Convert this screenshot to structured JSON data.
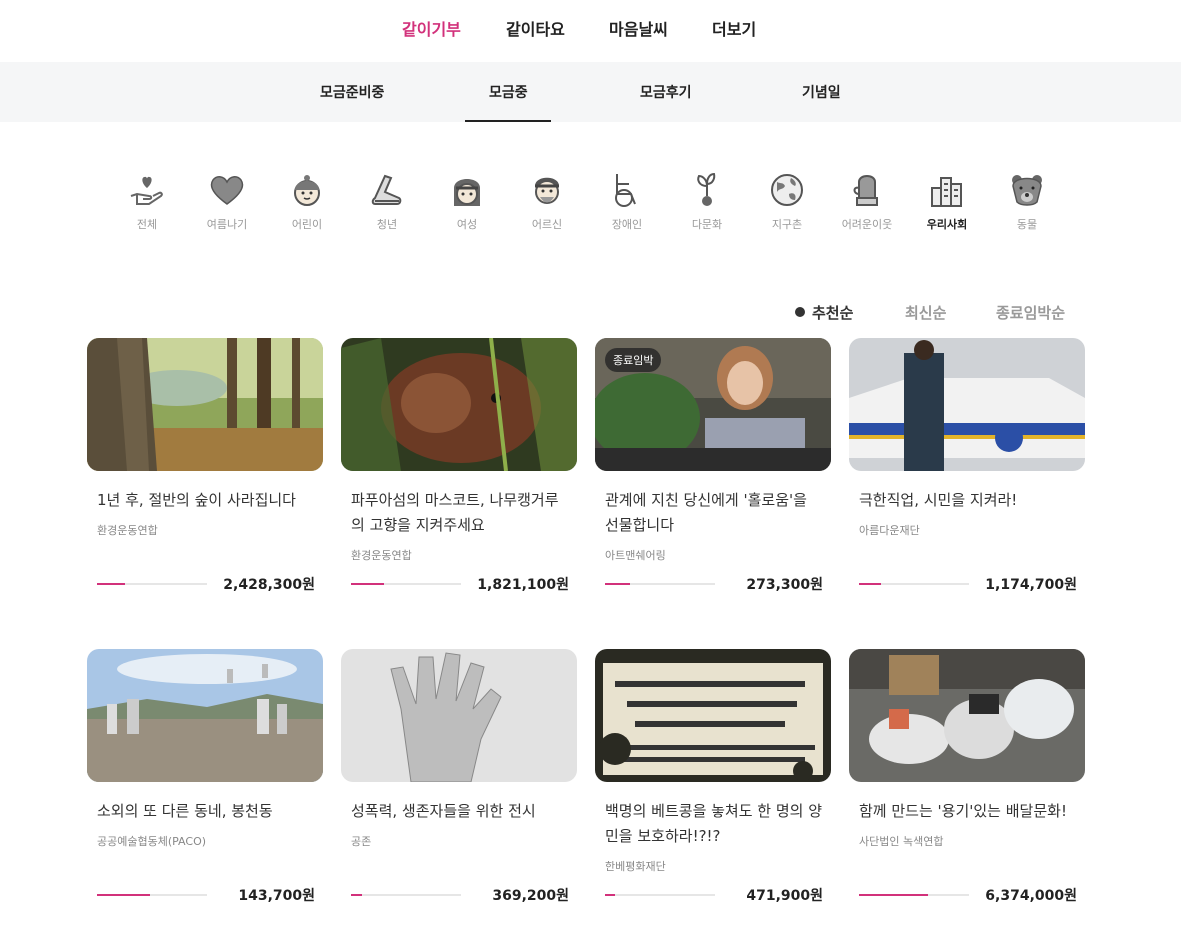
{
  "top_nav": [
    "같이기부",
    "같이타요",
    "마음날씨",
    "더보기"
  ],
  "sub_nav": [
    "모금준비중",
    "모금중",
    "모금후기",
    "기념일"
  ],
  "categories": [
    "전체",
    "여름나기",
    "어린이",
    "청년",
    "여성",
    "어르신",
    "장애인",
    "다문화",
    "지구촌",
    "어려운이웃",
    "우리사회",
    "동물"
  ],
  "sort": [
    "추천순",
    "최신순",
    "종료임박순"
  ],
  "accent_color": "#d2317b",
  "cards": [
    {
      "title": "1년 후, 절반의 숲이 사라집니다",
      "org": "환경운동연합",
      "amount": "2,428,300원",
      "progress": 0.25,
      "badge": ""
    },
    {
      "title": "파푸아섬의 마스코트, 나무캥거루의 고향을 지켜주세요",
      "org": "환경운동연합",
      "amount": "1,821,100원",
      "progress": 0.3,
      "badge": ""
    },
    {
      "title": "관계에 지친 당신에게 '홀로움'을 선물합니다",
      "org": "아트맨쉐어링",
      "amount": "273,300원",
      "progress": 0.23,
      "badge": "종료임박"
    },
    {
      "title": "극한직업, 시민을 지켜라!",
      "org": "아름다운재단",
      "amount": "1,174,700원",
      "progress": 0.2,
      "badge": ""
    },
    {
      "title": "소외의 또 다른 동네, 봉천동",
      "org": "공공예술협동체(PACO)",
      "amount": "143,700원",
      "progress": 0.48,
      "badge": ""
    },
    {
      "title": "성폭력, 생존자들을 위한 전시",
      "org": "공존",
      "amount": "369,200원",
      "progress": 0.1,
      "badge": ""
    },
    {
      "title": "백명의 베트콩을 놓쳐도 한 명의 양민을 보호하라!?!?",
      "org": "한베평화재단",
      "amount": "471,900원",
      "progress": 0.09,
      "badge": ""
    },
    {
      "title": "함께 만드는 '용기'있는 배달문화!",
      "org": "사단법인 녹색연합",
      "amount": "6,374,000원",
      "progress": 0.63,
      "badge": ""
    }
  ]
}
